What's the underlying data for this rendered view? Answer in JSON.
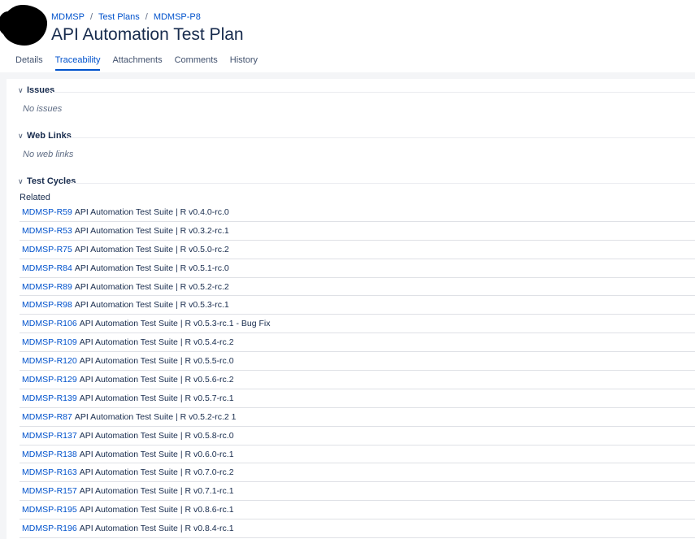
{
  "breadcrumb": {
    "project": "MDMSP",
    "section": "Test Plans",
    "key": "MDMSP-P8"
  },
  "page_title": "API Automation Test Plan",
  "tabs": [
    "Details",
    "Traceability",
    "Attachments",
    "Comments",
    "History"
  ],
  "active_tab": "Traceability",
  "icons": {
    "collapse": "chevron-down-icon"
  },
  "issues": {
    "title": "Issues",
    "empty": "No issues"
  },
  "web_links": {
    "title": "Web Links",
    "empty": "No web links"
  },
  "test_cycles": {
    "title": "Test Cycles",
    "related_label": "Related",
    "items": [
      {
        "key": "MDMSP-R59",
        "name": "API Automation Test Suite | R v0.4.0-rc.0"
      },
      {
        "key": "MDMSP-R53",
        "name": "API Automation Test Suite | R v0.3.2-rc.1"
      },
      {
        "key": "MDMSP-R75",
        "name": "API Automation Test Suite | R v0.5.0-rc.2"
      },
      {
        "key": "MDMSP-R84",
        "name": "API Automation Test Suite | R v0.5.1-rc.0"
      },
      {
        "key": "MDMSP-R89",
        "name": "API Automation Test Suite | R v0.5.2-rc.2"
      },
      {
        "key": "MDMSP-R98",
        "name": "API Automation Test Suite | R v0.5.3-rc.1"
      },
      {
        "key": "MDMSP-R106",
        "name": "API Automation Test Suite | R v0.5.3-rc.1 - Bug Fix"
      },
      {
        "key": "MDMSP-R109",
        "name": "API Automation Test Suite | R v0.5.4-rc.2"
      },
      {
        "key": "MDMSP-R120",
        "name": "API Automation Test Suite | R v0.5.5-rc.0"
      },
      {
        "key": "MDMSP-R129",
        "name": "API Automation Test Suite | R v0.5.6-rc.2"
      },
      {
        "key": "MDMSP-R139",
        "name": "API Automation Test Suite | R v0.5.7-rc.1"
      },
      {
        "key": "MDMSP-R87",
        "name": "API Automation Test Suite | R v0.5.2-rc.2 1"
      },
      {
        "key": "MDMSP-R137",
        "name": "API Automation Test Suite | R v0.5.8-rc.0"
      },
      {
        "key": "MDMSP-R138",
        "name": "API Automation Test Suite | R v0.6.0-rc.1"
      },
      {
        "key": "MDMSP-R163",
        "name": "API Automation Test Suite | R v0.7.0-rc.2"
      },
      {
        "key": "MDMSP-R157",
        "name": "API Automation Test Suite | R v0.7.1-rc.1"
      },
      {
        "key": "MDMSP-R195",
        "name": "API Automation Test Suite | R v0.8.6-rc.1"
      },
      {
        "key": "MDMSP-R196",
        "name": "API Automation Test Suite | R v0.8.4-rc.1"
      }
    ]
  }
}
